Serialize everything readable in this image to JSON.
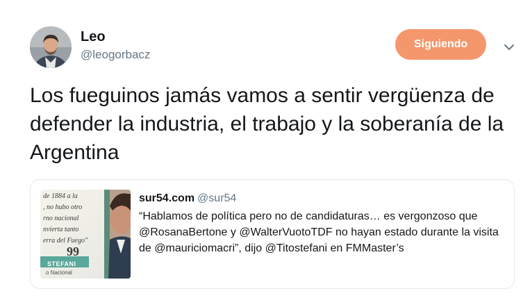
{
  "author": {
    "display_name": "Leo",
    "handle": "@leogorbacz",
    "avatar_icon": "user-avatar"
  },
  "follow_button": {
    "label": "Siguiendo",
    "color": "#f4976c"
  },
  "menu": {
    "icon": "chevron-down-icon"
  },
  "tweet": {
    "text": "Los fueguinos jamás vamos a sentir vergüenza de defender la industria, el trabajo y la soberanía de la Argentina"
  },
  "quoted_tweet": {
    "display_name": "sur54.com",
    "handle": "@sur54",
    "text": "“Hablamos de política pero no de candidaturas… es vergonzoso que @RosanaBertone y @WalterVuotoTDF no hayan estado durante la visita de @mauriciomacri”, dijo @Titostefani en FMMaster’s",
    "thumbnail": {
      "lines": [
        "de 1884 a la",
        ", no hubo otro",
        "rno nacional",
        "nvierta tanto",
        "erra del Fuego\""
      ],
      "quote_mark": "99",
      "name": "STEFANI",
      "subtitle": "o Nacional"
    }
  }
}
